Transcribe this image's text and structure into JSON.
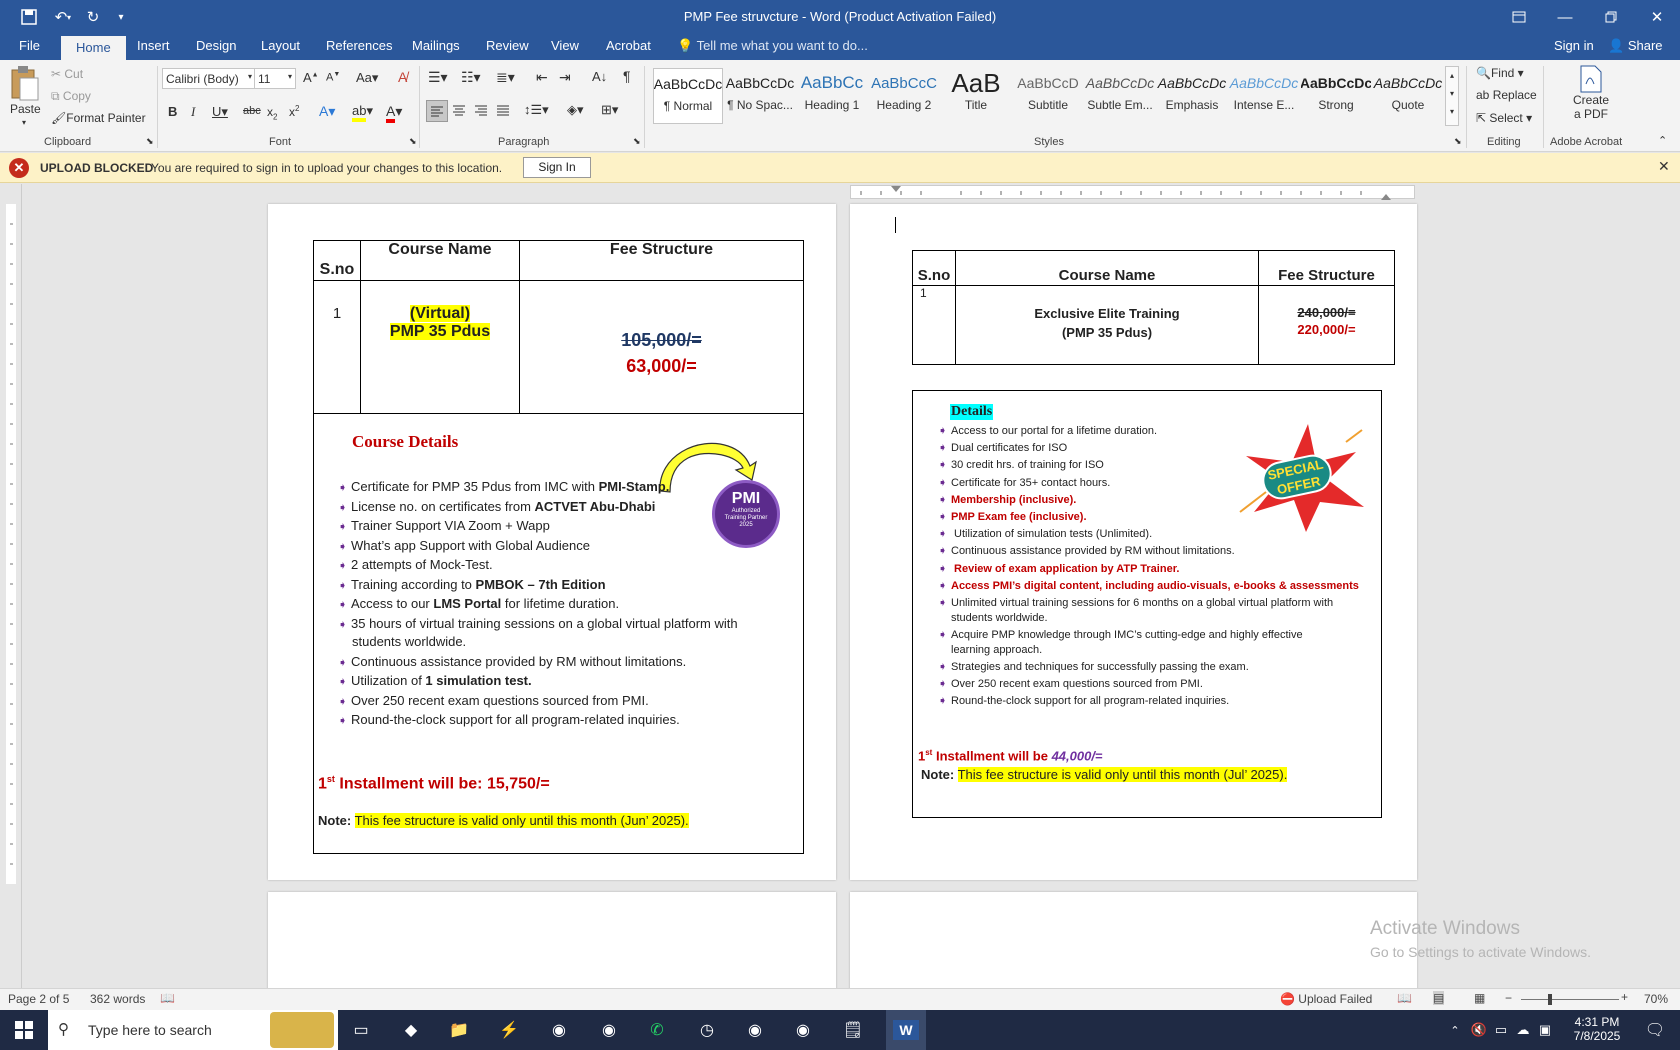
{
  "window": {
    "title": "PMP Fee struvcture - Word (Product Activation Failed)",
    "qat": [
      "save-icon",
      "undo-icon",
      "redo-icon",
      "customize-icon"
    ],
    "controls": [
      "ribbon-display-icon",
      "minimize-icon",
      "maximize-icon",
      "close-icon"
    ]
  },
  "tabs": [
    "File",
    "Home",
    "Insert",
    "Design",
    "Layout",
    "References",
    "Mailings",
    "Review",
    "View",
    "Acrobat"
  ],
  "tell_me": "Tell me what you want to do...",
  "sign_in": "Sign in",
  "share": "Share",
  "ribbon": {
    "clipboard": {
      "paste": "Paste",
      "cut": "Cut",
      "copy": "Copy",
      "format_painter": "Format Painter",
      "label": "Clipboard"
    },
    "font": {
      "name": "Calibri (Body)",
      "size": "11",
      "label": "Font"
    },
    "paragraph": {
      "label": "Paragraph"
    },
    "styles": {
      "label": "Styles",
      "items": [
        {
          "preview": "AaBbCcDc",
          "name": "¶ Normal"
        },
        {
          "preview": "AaBbCcDc",
          "name": "¶ No Spac..."
        },
        {
          "preview": "AaBbCc",
          "name": "Heading 1"
        },
        {
          "preview": "AaBbCcC",
          "name": "Heading 2"
        },
        {
          "preview": "AaB",
          "name": "Title"
        },
        {
          "preview": "AaBbCcD",
          "name": "Subtitle"
        },
        {
          "preview": "AaBbCcDc",
          "name": "Subtle Em..."
        },
        {
          "preview": "AaBbCcDc",
          "name": "Emphasis"
        },
        {
          "preview": "AaBbCcDc",
          "name": "Intense E..."
        },
        {
          "preview": "AaBbCcDc",
          "name": "Strong"
        },
        {
          "preview": "AaBbCcDc",
          "name": "Quote"
        }
      ]
    },
    "editing": {
      "find": "Find",
      "replace": "Replace",
      "select": "Select",
      "label": "Editing"
    },
    "acrobat": {
      "create_pdf_line1": "Create",
      "create_pdf_line2": "a PDF",
      "label": "Adobe Acrobat"
    }
  },
  "message_bar": {
    "title": "UPLOAD BLOCKED",
    "text": "You are required to sign in to upload your changes to this location.",
    "button": "Sign In"
  },
  "page_left": {
    "headers": {
      "sno": "S.no",
      "course": "Course Name",
      "fee": "Fee Structure"
    },
    "row": {
      "sno": "1",
      "course_line1": "(Virtual)",
      "course_line2": "PMP 35 Pdus",
      "old_fee": "105,000/=",
      "new_fee": "63,000/="
    },
    "details_title": "Course Details",
    "badge_text": "Authorized Training Partner 2025",
    "bullets": [
      {
        "pre": "Certificate for PMP 35 Pdus from IMC with ",
        "bold": "PMI-Stamp.",
        "post": ""
      },
      {
        "pre": "License no. on certificates from ",
        "bold": "ACTVET Abu-Dhabi",
        "post": ""
      },
      {
        "pre": "Trainer Support VIA Zoom + Wapp",
        "bold": "",
        "post": ""
      },
      {
        "pre": "What’s app Support with Global Audience",
        "bold": "",
        "post": ""
      },
      {
        "pre": "2 attempts of Mock-Test.",
        "bold": "",
        "post": ""
      },
      {
        "pre": "Training according to ",
        "bold": "PMBOK – 7th Edition",
        "post": ""
      },
      {
        "pre": "Access to our ",
        "bold": "LMS Portal",
        "post": " for lifetime duration."
      },
      {
        "pre": "35 hours of virtual training sessions on a global virtual platform with",
        "bold": "",
        "post": ""
      },
      {
        "pre": "students worldwide.",
        "bold": "",
        "post": "",
        "cont": true
      },
      {
        "pre": "Continuous assistance provided by RM without limitations.",
        "bold": "",
        "post": ""
      },
      {
        "pre": "Utilization of ",
        "bold": "1 simulation test.",
        "post": ""
      },
      {
        "pre": "Over 250 recent exam questions sourced from PMI.",
        "bold": "",
        "post": ""
      },
      {
        "pre": "Round-the-clock support for all program-related inquiries.",
        "bold": "",
        "post": ""
      }
    ],
    "installment": "Installment will be: 15,750/=",
    "installment_prefix": "1",
    "installment_sup": "st",
    "note_label": "Note:",
    "note_text": "This fee structure is valid only until this month (Jun’ 2025)."
  },
  "page_right": {
    "headers": {
      "sno": "S.no",
      "course": "Course Name",
      "fee": "Fee Structure"
    },
    "row": {
      "sno": "1",
      "course_line1": "Exclusive Elite Training",
      "course_line2": "(PMP 35 Pdus)",
      "old_fee": "240,000/=",
      "new_fee": "220,000/="
    },
    "details_title": "Details",
    "offer_line1": "SPECIAL",
    "offer_line2": "OFFER",
    "bullets": [
      {
        "text": "Access to our portal for a lifetime duration.",
        "style": "normal"
      },
      {
        "text": "Dual certificates for ISO",
        "style": "normal"
      },
      {
        "text": "30 credit hrs. of training for ISO",
        "style": "normal"
      },
      {
        "text": "Certificate for 35+ contact hours.",
        "style": "normal"
      },
      {
        "text": "Membership (inclusive).",
        "style": "red"
      },
      {
        "text": "PMP Exam fee (inclusive).",
        "style": "red"
      },
      {
        "text": " Utilization of simulation tests (Unlimited).",
        "style": "normal"
      },
      {
        "text": "Continuous assistance provided by RM without limitations.",
        "style": "normal"
      },
      {
        "text": " Review of exam application by ATP Trainer.",
        "style": "red"
      },
      {
        "text": "Access PMI’s digital content, including audio-visuals, e-books & assessments",
        "style": "red"
      },
      {
        "text": "Unlimited virtual training sessions for 6 months on a global virtual platform with",
        "style": "normal"
      },
      {
        "text": "students worldwide.",
        "style": "cont"
      },
      {
        "text": "Acquire PMP knowledge through IMC’s cutting-edge and highly effective",
        "style": "normal"
      },
      {
        "text": "learning approach.",
        "style": "cont"
      },
      {
        "text": "Strategies and techniques for successfully passing the exam.",
        "style": "normal"
      },
      {
        "text": "Over 250 recent exam questions sourced from PMI.",
        "style": "normal"
      },
      {
        "text": "Round-the-clock support for all program-related inquiries.",
        "style": "normal"
      }
    ],
    "installment_prefix": "1",
    "installment_sup": "st",
    "installment": "Installment will be ",
    "installment_value": "44,000/=",
    "note_label": "Note:",
    "note_text": "This fee structure is valid only until this month (Jul’ 2025)."
  },
  "watermark": {
    "line1": "Activate Windows",
    "line2": "Go to Settings to activate Windows."
  },
  "status": {
    "page": "Page 2 of 5",
    "words": "362 words",
    "upload": "Upload Failed",
    "zoom": "70%"
  },
  "taskbar": {
    "search": "Type here to search",
    "time": "4:31 PM",
    "date": "7/8/2025"
  }
}
